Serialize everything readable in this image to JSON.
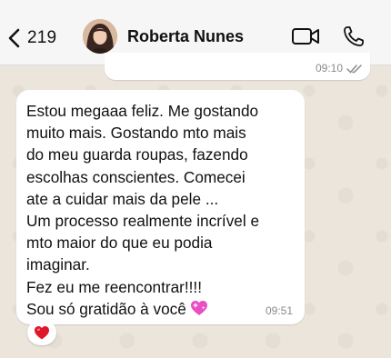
{
  "header": {
    "back_count": "219",
    "contact_name": "Roberta Nunes"
  },
  "outgoing_message": {
    "time": "09:10",
    "status": "read"
  },
  "incoming_message": {
    "lines": [
      "Estou megaaa feliz. Me gostando",
      "muito mais. Gostando mto mais",
      "do meu guarda roupas, fazendo",
      "escolhas conscientes. Comecei",
      "ate a cuidar mais da pele ...",
      "Um processo realmente incrível e",
      "mto maior do que eu podia",
      "imaginar.",
      "Fez eu me reencontrar!!!!",
      "Sou só gratidão à você"
    ],
    "emoji": "sparkling-heart",
    "time": "09:51",
    "reaction": "red-heart"
  },
  "colors": {
    "chat_background": "#ece5dc",
    "bubble": "#ffffff",
    "heart_red": "#e0162b",
    "sparkling_heart": "#e84fc4"
  }
}
